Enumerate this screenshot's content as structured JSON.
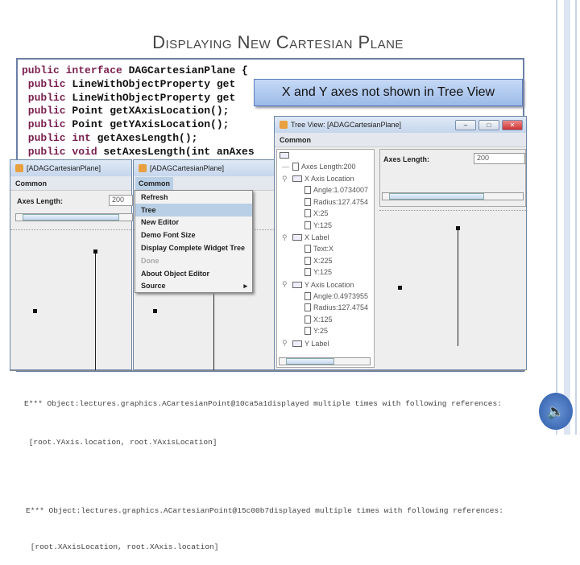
{
  "slide": {
    "title": "Displaying New Cartesian Plane"
  },
  "code": {
    "lines": [
      {
        "kw": "public interface",
        "rest": " DAGCartesianPlane {"
      },
      {
        "kw": " public",
        "rest": " LineWithObjectProperty get"
      },
      {
        "kw": " public",
        "rest": " LineWithObjectProperty get"
      },
      {
        "kw": " public",
        "rest": " Point getXAxisLocation();"
      },
      {
        "kw": " public",
        "rest": " Point getYAxisLocation();"
      },
      {
        "kw": " public int",
        "rest": " getAxesLength();"
      },
      {
        "kw": " public void",
        "rest": " setAxesLength(int anAxes"
      }
    ]
  },
  "callout": "X and Y axes not shown in Tree View",
  "window1": {
    "title": "[ADAGCartesianPlane]",
    "menu": "Common",
    "field_label": "Axes Length:",
    "field_value": "200"
  },
  "window2": {
    "title": "[ADAGCartesianPlane]",
    "menu": "Common",
    "menu_items": [
      {
        "label": "Refresh",
        "state": "normal"
      },
      {
        "label": "Tree",
        "state": "selected"
      },
      {
        "label": "New Editor",
        "state": "normal"
      },
      {
        "label": "Demo Font Size",
        "state": "normal"
      },
      {
        "label": "Display Complete Widget Tree",
        "state": "normal"
      },
      {
        "label": "Done",
        "state": "disabled"
      },
      {
        "label": "About Object Editor",
        "state": "normal"
      },
      {
        "label": "Source",
        "state": "submenu"
      }
    ]
  },
  "tree_window": {
    "title": "Tree View: [ADAGCartesianPlane]",
    "menu": "Common",
    "field_label": "Axes Length:",
    "field_value": "200",
    "tree": [
      {
        "label": "Axes Length:200",
        "type": "leaf",
        "level": 1
      },
      {
        "label": "X Axis Location",
        "type": "folder",
        "level": 1
      },
      {
        "label": "Angle:1.0734007",
        "type": "leaf",
        "level": 2
      },
      {
        "label": "Radius:127.4754",
        "type": "leaf",
        "level": 2
      },
      {
        "label": "X:25",
        "type": "leaf",
        "level": 2
      },
      {
        "label": "Y:125",
        "type": "leaf",
        "level": 2
      },
      {
        "label": "X Label",
        "type": "folder",
        "level": 1
      },
      {
        "label": "Text:X",
        "type": "leaf",
        "level": 2
      },
      {
        "label": "X:225",
        "type": "leaf",
        "level": 2
      },
      {
        "label": "Y:125",
        "type": "leaf",
        "level": 2
      },
      {
        "label": "Y Axis Location",
        "type": "folder",
        "level": 1
      },
      {
        "label": "Angle:0.4973955",
        "type": "leaf",
        "level": 2
      },
      {
        "label": "Radius:127.4754",
        "type": "leaf",
        "level": 2
      },
      {
        "label": "X:125",
        "type": "leaf",
        "level": 2
      },
      {
        "label": "Y:25",
        "type": "leaf",
        "level": 2
      },
      {
        "label": "Y Label",
        "type": "folder",
        "level": 1
      }
    ]
  },
  "console": [
    "E*** Object:lectures.graphics.ACartesianPoint@10ca5a1displayed multiple times with following references:",
    " [root.YAxis.location, root.YAxisLocation]",
    "E*** Object:lectures.graphics.ACartesianPoint@15c00b7displayed multiple times with following references:",
    " [root.XAxisLocation, root.XAxis.location]"
  ]
}
